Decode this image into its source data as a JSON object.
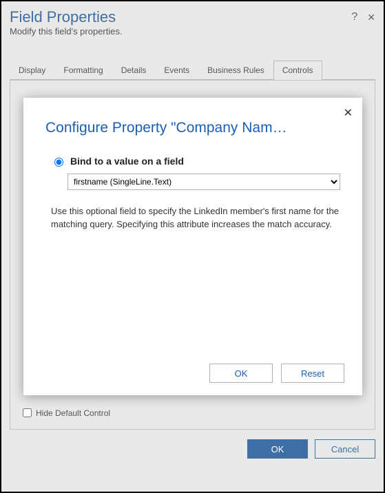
{
  "header": {
    "title": "Field Properties",
    "subtitle": "Modify this field's properties.",
    "help_icon": "?",
    "close_icon": "✕"
  },
  "tabs": [
    {
      "label": "Display"
    },
    {
      "label": "Formatting"
    },
    {
      "label": "Details"
    },
    {
      "label": "Events"
    },
    {
      "label": "Business Rules"
    },
    {
      "label": "Controls"
    }
  ],
  "panel": {
    "hide_default_label": "Hide Default Control"
  },
  "footer": {
    "ok": "OK",
    "cancel": "Cancel"
  },
  "modal": {
    "close_icon": "✕",
    "title": "Configure Property \"Company Nam…",
    "radio_label": "Bind to a value on a field",
    "select_value": "firstname (SingleLine.Text)",
    "select_options": [
      "firstname (SingleLine.Text)"
    ],
    "description": "Use this optional field to specify the LinkedIn member's first name for the matching query. Specifying this attribute increases the match accuracy.",
    "ok": "OK",
    "reset": "Reset"
  }
}
